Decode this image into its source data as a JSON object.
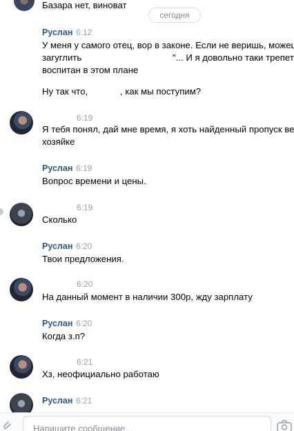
{
  "date_separator": "сегодня",
  "top_partial": {
    "text": "Базара нет, виноват"
  },
  "messages": [
    {
      "author": "Руслан",
      "time": "6:12",
      "lines": [
        "У меня у самого отец, вор в законе. Если не веришь, можеш",
        "загуглить",
        "\"... И я довольно таки трепетн",
        "воспитан в этом плане"
      ],
      "extra": "Ну так что,",
      "extra_tail": ", как мы поступим?"
    },
    {
      "author": "",
      "time": "6:19",
      "lines": [
        "Я тебя понял, дай мне время, я хоть найденный пропуск вер",
        "хозяйке"
      ]
    },
    {
      "author": "Руслан",
      "time": "6:19",
      "lines": [
        "Вопрос времени и цены."
      ]
    },
    {
      "author": "",
      "time": "6:19",
      "lines": [
        "Сколько"
      ]
    },
    {
      "author": "Руслан",
      "time": "6:20",
      "lines": [
        "Твои предложения."
      ]
    },
    {
      "author": "",
      "time": "6:20",
      "lines": [
        "На данный момент в наличии 300р, жду зарплату"
      ]
    },
    {
      "author": "Руслан",
      "time": "6:20",
      "lines": [
        "Когда з.п?"
      ]
    },
    {
      "author": "",
      "time": "6:21",
      "lines": [
        "Хз, неофициально работаю"
      ]
    },
    {
      "author": "Руслан",
      "time": "6:21",
      "lines": []
    }
  ],
  "composer": {
    "placeholder": "Напишите сообщение..."
  },
  "icons": {
    "attach": "paperclip-icon",
    "camera": "camera-icon"
  },
  "colors": {
    "author": "#2a5885",
    "time": "#9aa1aa",
    "divider": "#d8dde3"
  }
}
